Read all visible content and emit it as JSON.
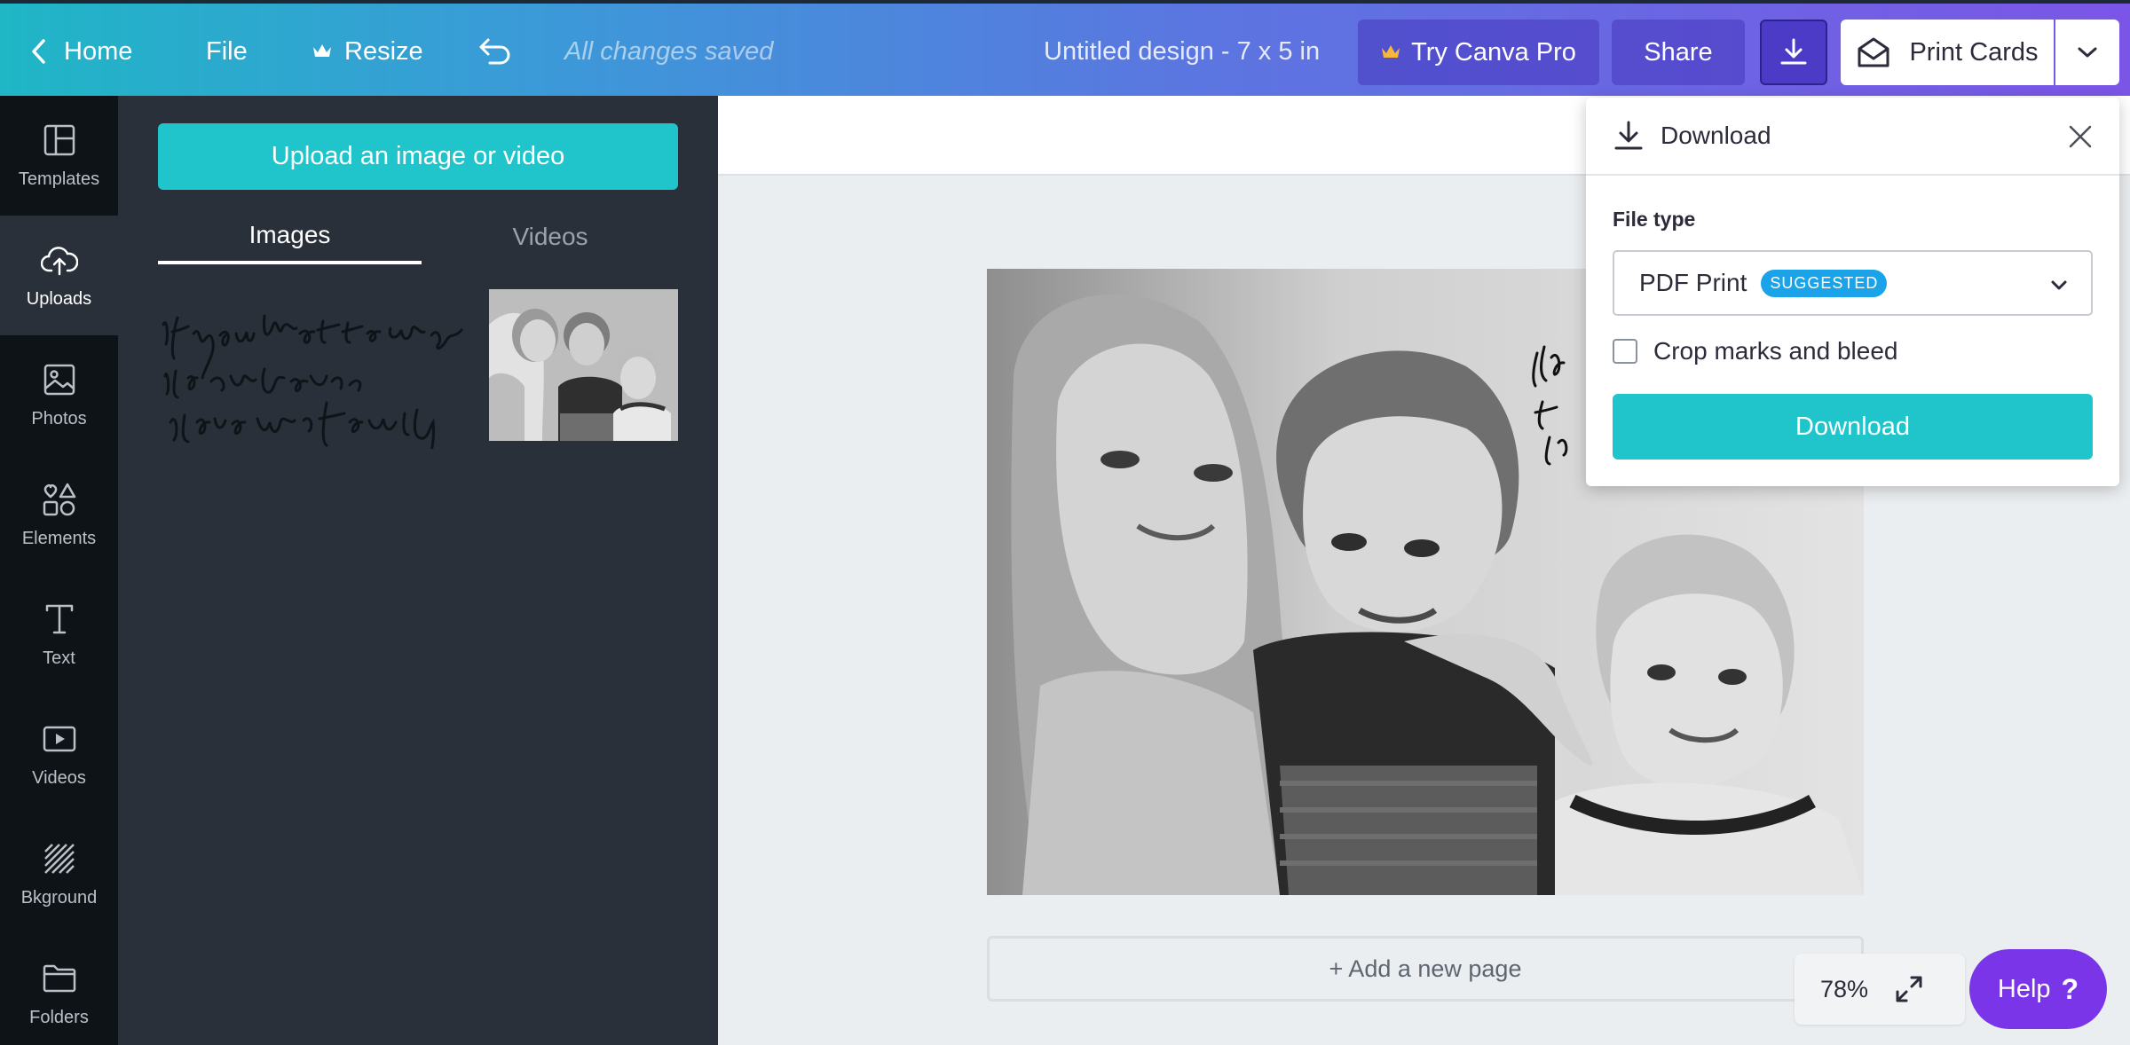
{
  "topbar": {
    "home_label": "Home",
    "file_label": "File",
    "resize_label": "Resize",
    "save_status": "All changes saved",
    "doc_title": "Untitled design - 7 x 5 in",
    "try_pro_label": "Try Canva Pro",
    "share_label": "Share",
    "print_label": "Print Cards"
  },
  "rail": {
    "items": [
      {
        "label": "Templates",
        "icon": "templates-icon"
      },
      {
        "label": "Uploads",
        "icon": "upload-cloud-icon"
      },
      {
        "label": "Photos",
        "icon": "photo-icon"
      },
      {
        "label": "Elements",
        "icon": "shapes-icon"
      },
      {
        "label": "Text",
        "icon": "text-icon"
      },
      {
        "label": "Videos",
        "icon": "video-icon"
      },
      {
        "label": "Bkground",
        "icon": "background-icon"
      },
      {
        "label": "Folders",
        "icon": "folder-icon"
      }
    ],
    "active": "Uploads"
  },
  "panel": {
    "upload_label": "Upload an image or video",
    "tabs": [
      "Images",
      "Videos"
    ],
    "active_tab": "Images"
  },
  "canvas": {
    "add_page_label": "+ Add a new page",
    "zoom": "78%",
    "help_label": "Help",
    "help_symbol": "?"
  },
  "download_popover": {
    "title": "Download",
    "file_type_label": "File type",
    "file_type_value": "PDF Print",
    "badge": "SUGGESTED",
    "crop_label": "Crop marks and bleed",
    "crop_checked": false,
    "button_label": "Download"
  },
  "colors": {
    "accent_teal": "#20c4cb",
    "help_purple": "#7b35e8",
    "badge_blue": "#1aa3e8",
    "rail_bg": "#0e1318",
    "panel_bg": "#293039"
  }
}
